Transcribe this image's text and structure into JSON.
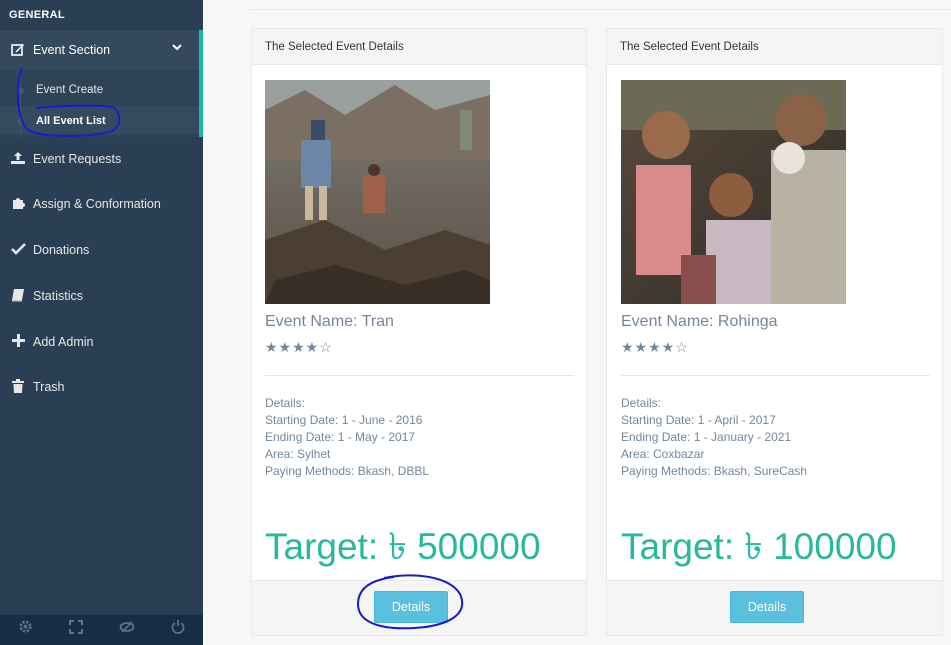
{
  "sidebar": {
    "section_title": "GENERAL",
    "event_section": {
      "label": "Event Section",
      "icon": "edit-icon"
    },
    "submenu": [
      {
        "label": "Event Create"
      },
      {
        "label": "All Event List",
        "active": true
      }
    ],
    "items": [
      {
        "label": "Event Requests",
        "icon": "upload-icon"
      },
      {
        "label": "Assign & Conformation",
        "icon": "puzzle-icon"
      },
      {
        "label": "Donations",
        "icon": "check-icon"
      },
      {
        "label": "Statistics",
        "icon": "book-icon"
      },
      {
        "label": "Add Admin",
        "icon": "plus-icon"
      },
      {
        "label": "Trash",
        "icon": "trash-icon"
      }
    ],
    "footer_icons": [
      "settings-icon",
      "fullscreen-icon",
      "hide-icon",
      "power-icon"
    ]
  },
  "cards": [
    {
      "header": "The Selected Event Details",
      "event_name": "Event Name: Tran",
      "stars": "★★★★☆",
      "details_heading": "Details:",
      "starting": "Starting Date: 1 - June - 2016",
      "ending": "Ending Date: 1 - May - 2017",
      "area": "Area: Sylhet",
      "paying": "Paying Methods: Bkash, DBBL",
      "target": "Target: ৳ 500000",
      "button": "Details"
    },
    {
      "header": "The Selected Event Details",
      "event_name": "Event Name: Rohinga",
      "stars": "★★★★☆",
      "details_heading": "Details:",
      "starting": "Starting Date: 1 - April - 2017",
      "ending": "Ending Date: 1 - January - 2021",
      "area": "Area: Coxbazar",
      "paying": "Paying Methods: Bkash, SureCash",
      "target": "Target: ৳ 100000",
      "button": "Details"
    }
  ],
  "colors": {
    "sidebar": "#2a3f54",
    "accent": "#1abb9c",
    "target": "#26b99a",
    "button": "#5bc0de",
    "annotation": "#1a1acc"
  }
}
